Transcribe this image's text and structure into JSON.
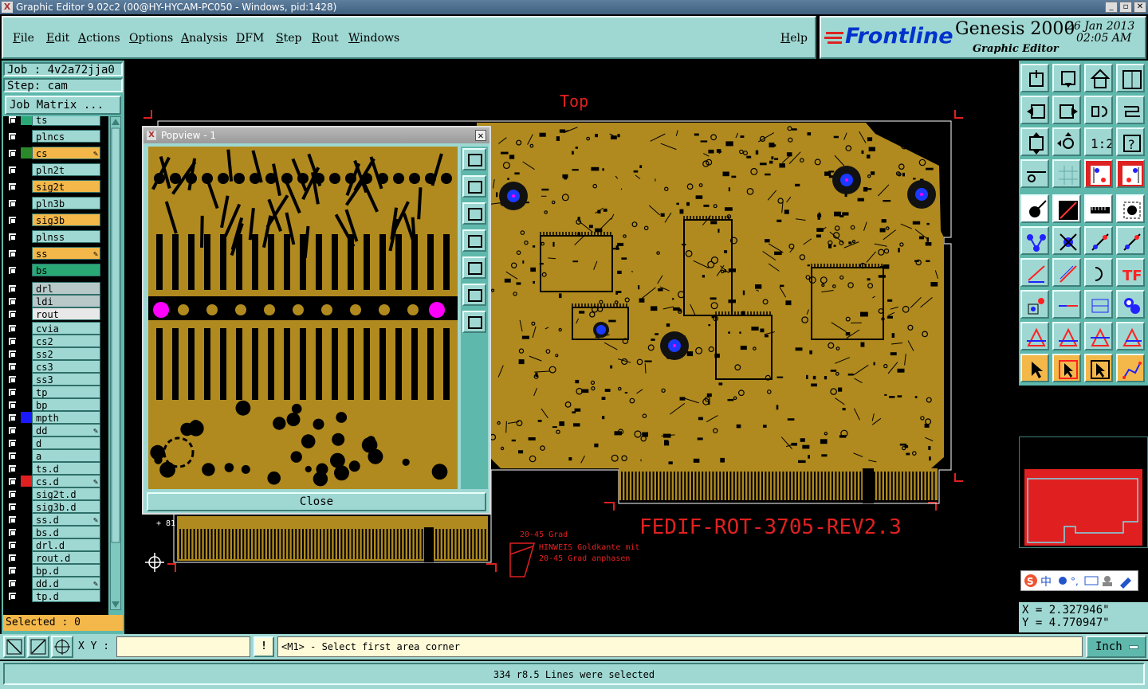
{
  "window": {
    "title": "Graphic Editor 9.02c2 (00@HY-HYCAM-PC050 - Windows, pid:1428)"
  },
  "menu": [
    "File",
    "Edit",
    "Actions",
    "Options",
    "Analysis",
    "DFM",
    "Step",
    "Rout",
    "Windows"
  ],
  "help_label": "Help",
  "banner": {
    "brand": "Frontline",
    "product": "Genesis 2000",
    "subtitle": "Graphic Editor",
    "date": "26 Jan 2013",
    "time": "02:05 AM"
  },
  "job": {
    "job_label": "Job : 4v2a72jja0",
    "step_label": "Step: cam",
    "matrix_button": "Job Matrix ..."
  },
  "layers": [
    {
      "name": "ts",
      "color": "#2aa876",
      "state": "normal"
    },
    {
      "name": "plncs",
      "color": "#000",
      "state": "normal"
    },
    {
      "name": "cs",
      "color": "#2a8a2a",
      "state": "work",
      "pen": true
    },
    {
      "name": "pln2t",
      "color": "#000",
      "state": "normal"
    },
    {
      "name": "sig2t",
      "color": "#000",
      "state": "affected"
    },
    {
      "name": "pln3b",
      "color": "#000",
      "state": "normal"
    },
    {
      "name": "sig3b",
      "color": "#000",
      "state": "affected"
    },
    {
      "name": "plnss",
      "color": "#000",
      "state": "normal"
    },
    {
      "name": "ss",
      "color": "#000",
      "state": "affected",
      "pen": true
    },
    {
      "name": "bs",
      "color": "#000",
      "state": "green"
    },
    {
      "name": "drl",
      "color": "#000",
      "state": "grey"
    },
    {
      "name": "ldi",
      "color": "#000",
      "state": "grey"
    },
    {
      "name": "rout",
      "color": "#000",
      "state": "light"
    },
    {
      "name": "cvia",
      "color": "#000",
      "state": "normal"
    },
    {
      "name": "cs2",
      "color": "#000",
      "state": "normal"
    },
    {
      "name": "ss2",
      "color": "#000",
      "state": "normal"
    },
    {
      "name": "cs3",
      "color": "#000",
      "state": "normal"
    },
    {
      "name": "ss3",
      "color": "#000",
      "state": "normal"
    },
    {
      "name": "tp",
      "color": "#000",
      "state": "normal"
    },
    {
      "name": "bp",
      "color": "#000",
      "state": "normal"
    },
    {
      "name": "mpth",
      "color": "#1a1aff",
      "state": "normal"
    },
    {
      "name": "dd",
      "color": "#000",
      "state": "normal",
      "pen": true
    },
    {
      "name": "d",
      "color": "#000",
      "state": "normal"
    },
    {
      "name": "a",
      "color": "#000",
      "state": "normal"
    },
    {
      "name": "ts.d",
      "color": "#000",
      "state": "normal"
    },
    {
      "name": "cs.d",
      "color": "#e02020",
      "state": "normal",
      "pen": true
    },
    {
      "name": "sig2t.d",
      "color": "#000",
      "state": "normal"
    },
    {
      "name": "sig3b.d",
      "color": "#000",
      "state": "normal"
    },
    {
      "name": "ss.d",
      "color": "#000",
      "state": "normal",
      "pen": true
    },
    {
      "name": "bs.d",
      "color": "#000",
      "state": "normal"
    },
    {
      "name": "drl.d",
      "color": "#000",
      "state": "normal"
    },
    {
      "name": "rout.d",
      "color": "#000",
      "state": "normal"
    },
    {
      "name": "bp.d",
      "color": "#000",
      "state": "normal"
    },
    {
      "name": "dd.d",
      "color": "#000",
      "state": "normal",
      "pen": true
    },
    {
      "name": "tp.d",
      "color": "#000",
      "state": "normal"
    }
  ],
  "selected_label": "Selected : 0",
  "canvas": {
    "top_label": "Top",
    "part_label": "FEDIF-ROT-3705-REV2.3",
    "note_line1": "20-45 Grad",
    "note_line2": "HINWEIS Goldkante mit",
    "note_line3": "20-45 Grad anphasen",
    "corner_label": "+ 81"
  },
  "popview": {
    "title": "Popview - 1",
    "close_label": "Close"
  },
  "coords": {
    "x": "X = 2.327946\"",
    "y": "Y = 4.770947\""
  },
  "command": {
    "xy_label": "X Y :",
    "xy_value": "",
    "prompt": "<M1> - Select first area corner",
    "unit": "Inch"
  },
  "status": "334 r8.5 Lines were selected",
  "colors": {
    "panel": "#9fd8d2",
    "copper": "#b08a1e",
    "work_layer": "#f4b84a",
    "outline": "#e02020"
  }
}
